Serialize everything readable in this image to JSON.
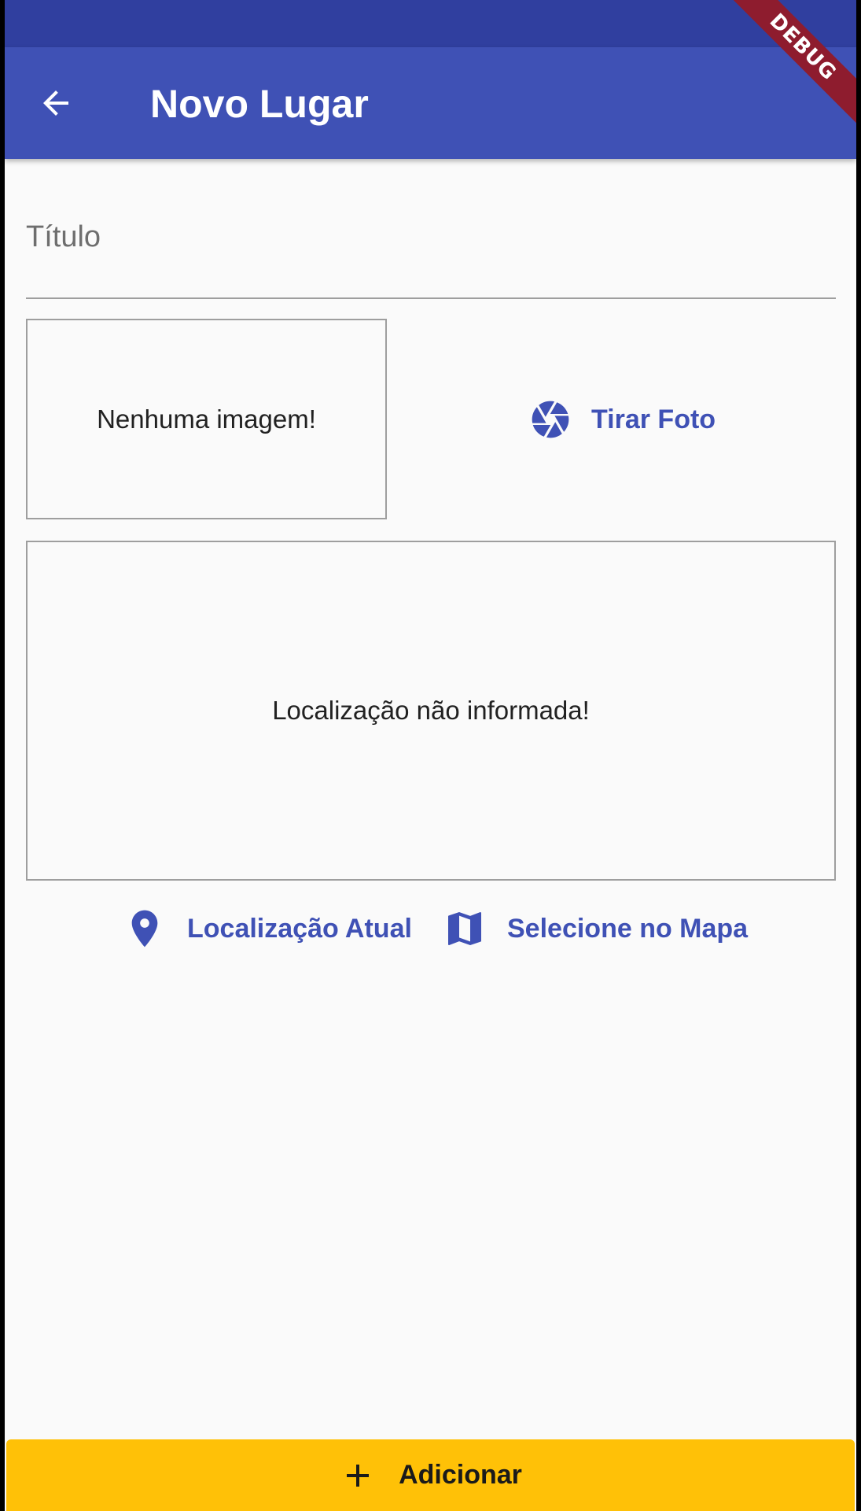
{
  "app_bar": {
    "title": "Novo Lugar",
    "back_icon": "arrow-back-icon",
    "color": "#3f51b5",
    "status_color": "#303f9f"
  },
  "debug_banner": "DEBUG",
  "form": {
    "title_placeholder": "Título",
    "image_placeholder": "Nenhuma imagem!",
    "take_photo_label": "Tirar Foto",
    "location_placeholder": "Localização não informada!",
    "current_location_label": "Localização Atual",
    "select_on_map_label": "Selecione no Mapa"
  },
  "add_button": {
    "label": "Adicionar",
    "color": "#ffc107"
  },
  "icons": {
    "camera": "camera-aperture-icon",
    "location": "location-pin-icon",
    "map": "map-icon",
    "add": "plus-icon"
  }
}
